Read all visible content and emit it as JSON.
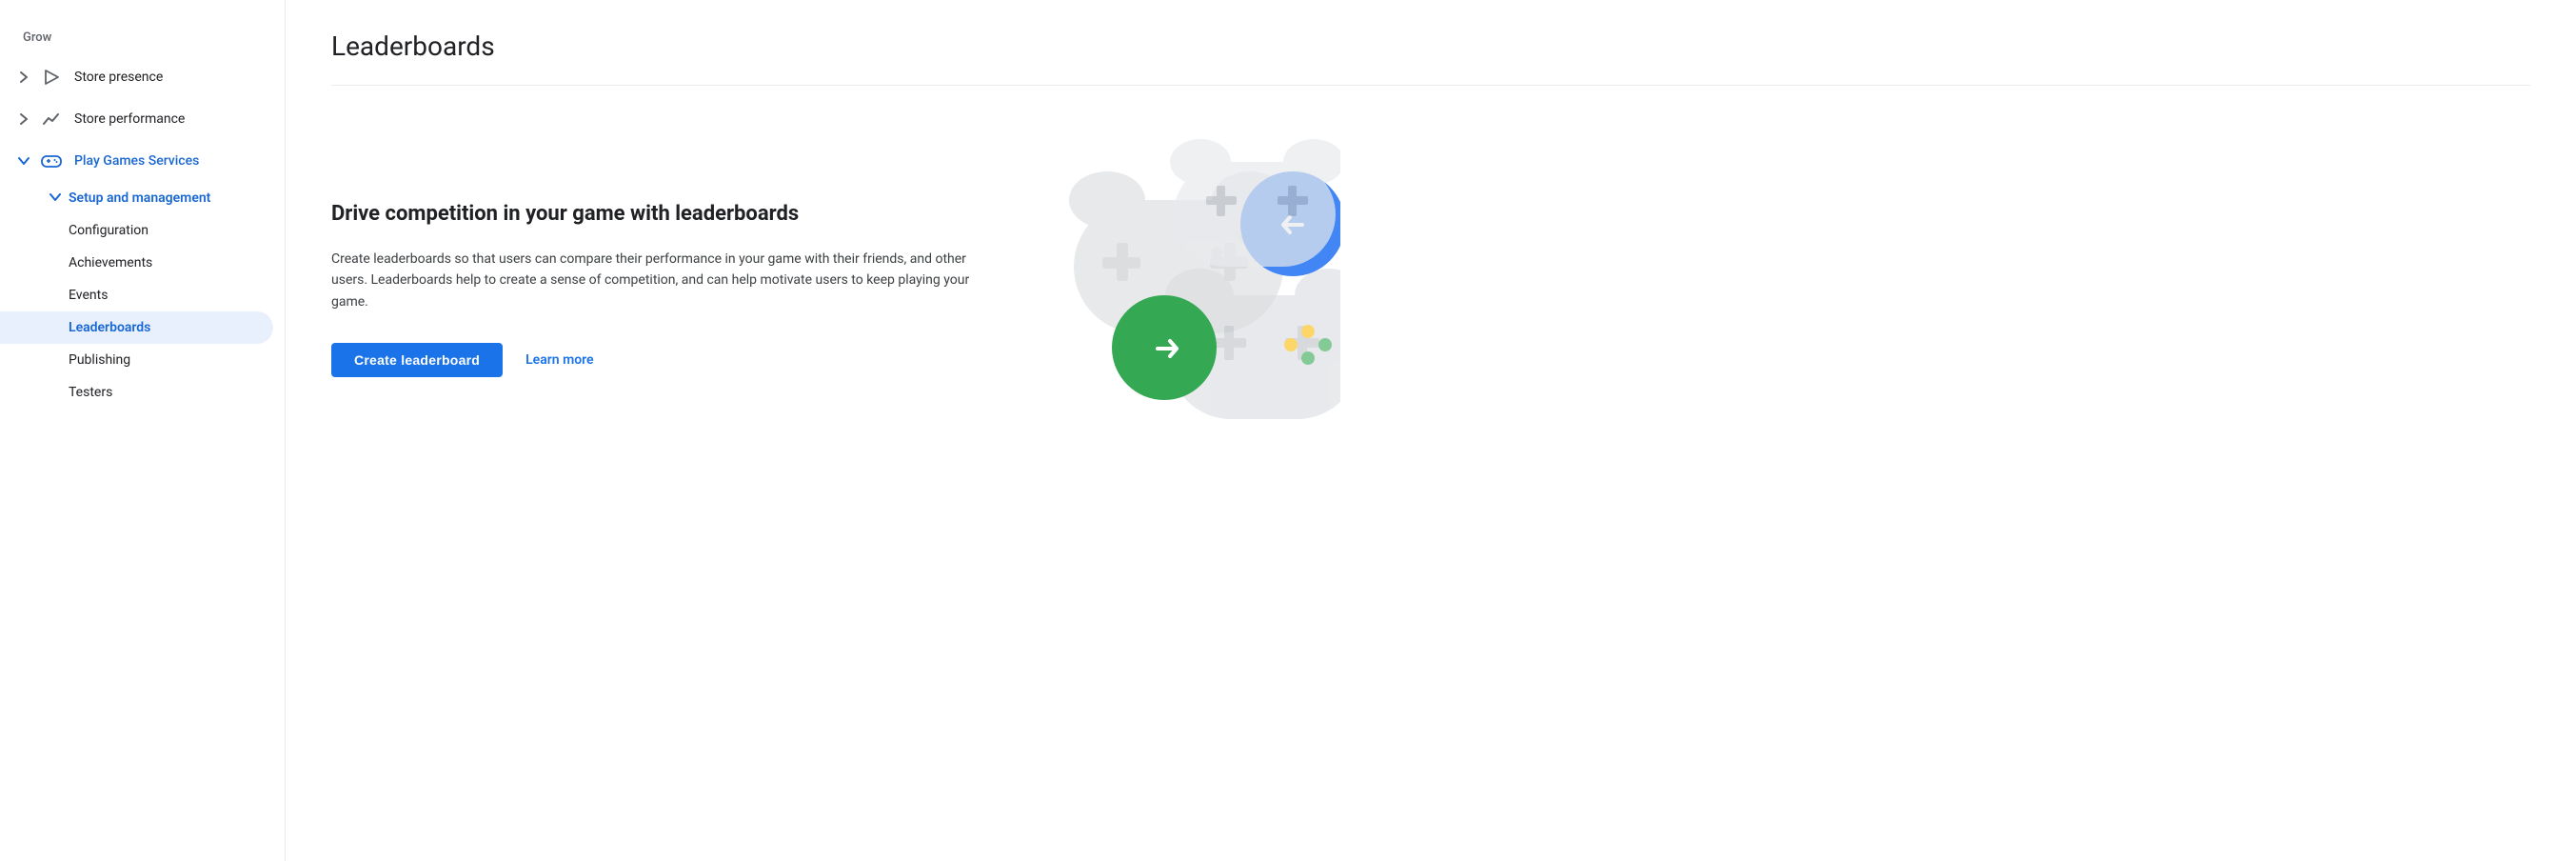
{
  "sidebar": {
    "section_label": "Grow",
    "items": [
      {
        "id": "store-presence",
        "label": "Store presence",
        "icon": "play-triangle-icon",
        "expandable": true,
        "expanded": false,
        "level": 0
      },
      {
        "id": "store-performance",
        "label": "Store performance",
        "icon": "trend-icon",
        "expandable": true,
        "expanded": false,
        "level": 0
      },
      {
        "id": "play-games-services",
        "label": "Play Games Services",
        "icon": "gamepad-icon",
        "expandable": true,
        "expanded": true,
        "level": 0,
        "active": true
      }
    ],
    "sub_items": [
      {
        "id": "setup-management",
        "label": "Setup and management",
        "expandable": true,
        "expanded": true,
        "level": 1,
        "active": true
      }
    ],
    "sub_sub_items": [
      {
        "id": "configuration",
        "label": "Configuration",
        "active": false
      },
      {
        "id": "achievements",
        "label": "Achievements",
        "active": false
      },
      {
        "id": "events",
        "label": "Events",
        "active": false
      },
      {
        "id": "leaderboards",
        "label": "Leaderboards",
        "active": true
      },
      {
        "id": "publishing",
        "label": "Publishing",
        "active": false
      },
      {
        "id": "testers",
        "label": "Testers",
        "active": false
      }
    ]
  },
  "main": {
    "page_title": "Leaderboards",
    "section_heading": "Drive competition in your game with leaderboards",
    "section_description": "Create leaderboards so that users can compare their performance in your game with their friends, and other users. Leaderboards help to create a sense of competition, and can help motivate users to keep playing your game.",
    "create_button_label": "Create leaderboard",
    "learn_more_label": "Learn more"
  },
  "colors": {
    "primary_blue": "#1a73e8",
    "text_dark": "#202124",
    "text_mid": "#3c4043",
    "text_light": "#5f6368",
    "sidebar_active_bg": "#e8f0fe",
    "sidebar_active_text": "#1967d2",
    "divider": "#e8eaed",
    "green": "#34a853",
    "blue_circle": "#4285f4",
    "yellow": "#fbbc04",
    "gamepad_gray": "#bdc1c6"
  }
}
